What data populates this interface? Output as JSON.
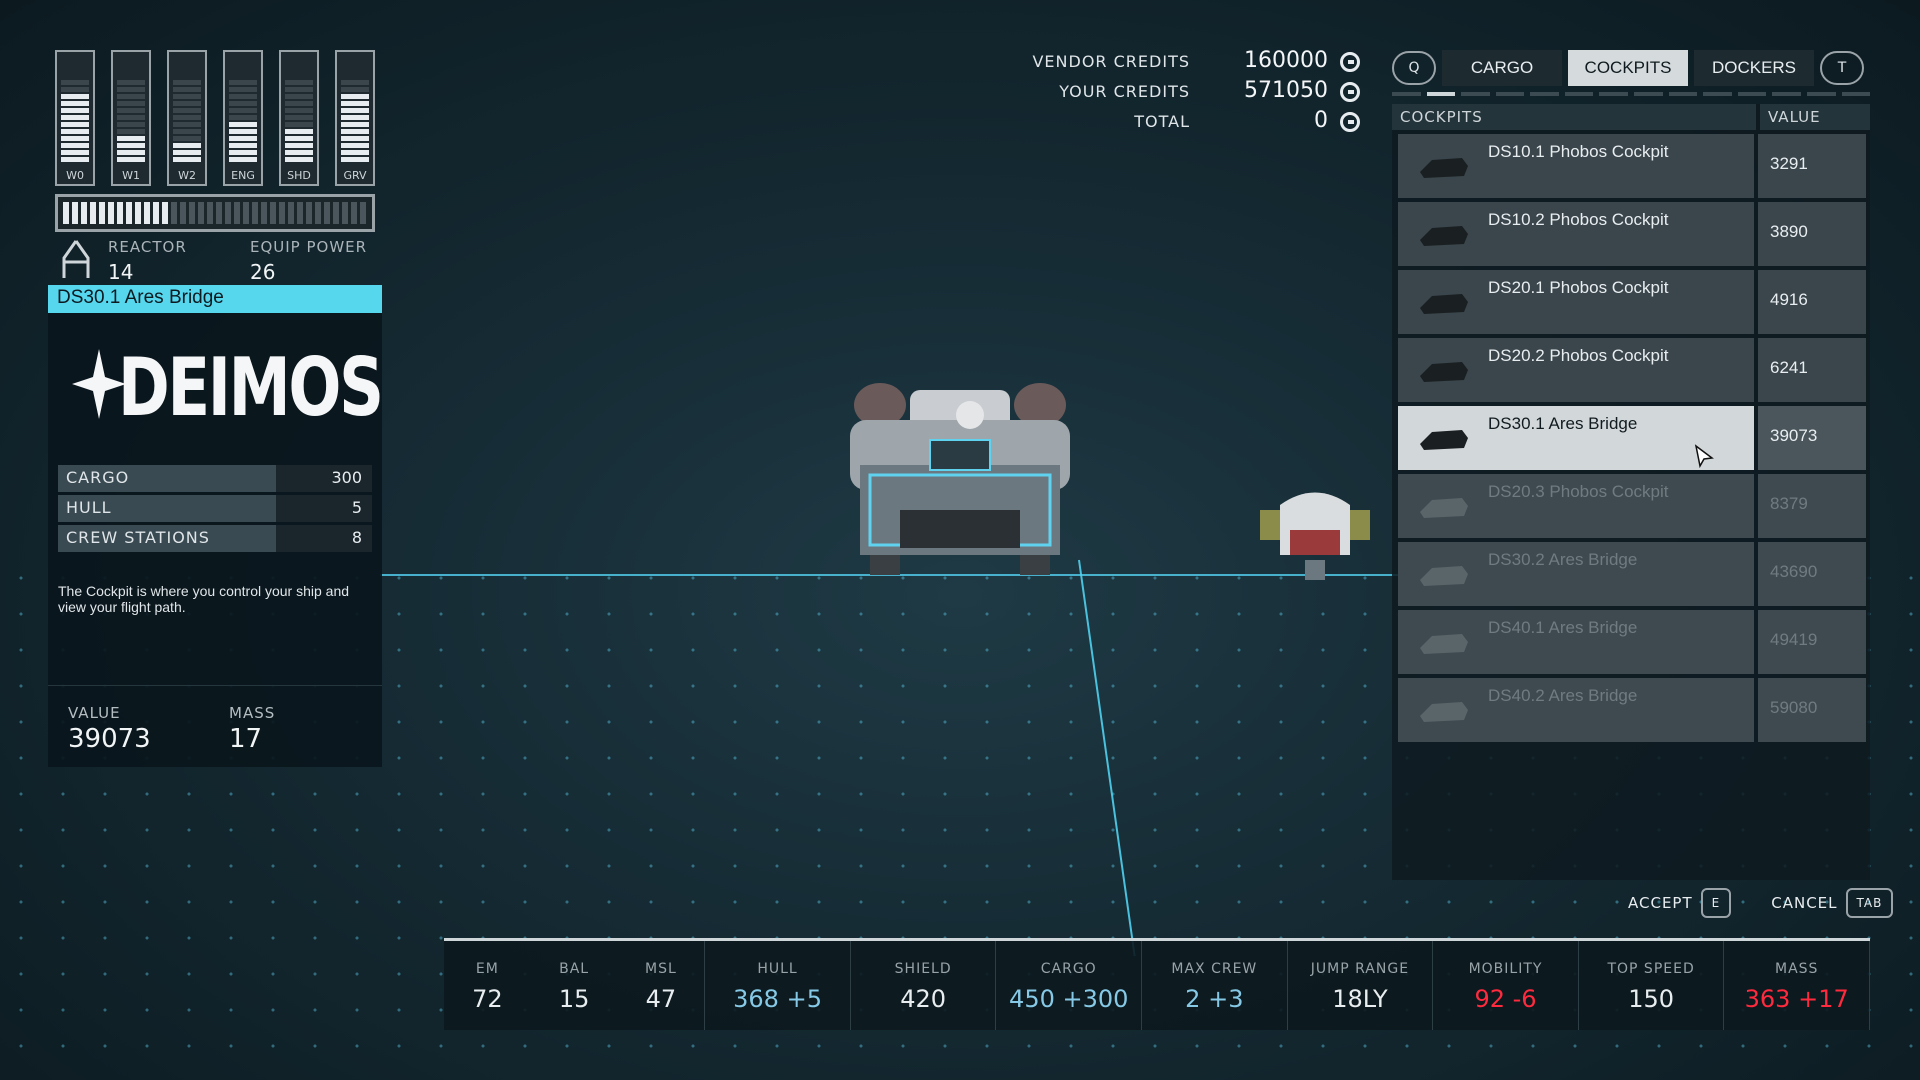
{
  "power_bars": [
    {
      "label": "W0",
      "level": 10
    },
    {
      "label": "W1",
      "level": 4
    },
    {
      "label": "W2",
      "level": 3
    },
    {
      "label": "ENG",
      "level": 6
    },
    {
      "label": "SHD",
      "level": 5
    },
    {
      "label": "GRV",
      "level": 10
    }
  ],
  "reactor": {
    "label": "REACTOR",
    "value": "14",
    "equip_label": "EQUIP POWER",
    "equip_value": "26",
    "fill": 0.35
  },
  "module": {
    "title": "DS30.1 Ares Bridge",
    "brand": "DEIMOS",
    "stats": [
      {
        "label": "CARGO",
        "value": "300"
      },
      {
        "label": "HULL",
        "value": "5"
      },
      {
        "label": "CREW STATIONS",
        "value": "8"
      }
    ],
    "description": "The Cockpit is where you control your ship and view your flight path.",
    "value_label": "VALUE",
    "value": "39073",
    "mass_label": "MASS",
    "mass": "17"
  },
  "credits": [
    {
      "label": "VENDOR CREDITS",
      "value": "160000"
    },
    {
      "label": "YOUR CREDITS",
      "value": "571050"
    },
    {
      "label": "TOTAL",
      "value": "0"
    }
  ],
  "tabs": {
    "prev_key": "Q",
    "next_key": "T",
    "items": [
      "CARGO",
      "COCKPITS",
      "DOCKERS"
    ],
    "active": "COCKPITS"
  },
  "list": {
    "col_name": "COCKPITS",
    "col_value": "VALUE",
    "items": [
      {
        "name": "DS10.1 Phobos Cockpit",
        "value": "3291",
        "state": "normal"
      },
      {
        "name": "DS10.2 Phobos Cockpit",
        "value": "3890",
        "state": "normal"
      },
      {
        "name": "DS20.1 Phobos Cockpit",
        "value": "4916",
        "state": "normal"
      },
      {
        "name": "DS20.2 Phobos Cockpit",
        "value": "6241",
        "state": "normal"
      },
      {
        "name": "DS30.1 Ares Bridge",
        "value": "39073",
        "state": "selected"
      },
      {
        "name": "DS20.3 Phobos Cockpit",
        "value": "8379",
        "state": "disabled"
      },
      {
        "name": "DS30.2 Ares Bridge",
        "value": "43690",
        "state": "disabled"
      },
      {
        "name": "DS40.1 Ares Bridge",
        "value": "49419",
        "state": "disabled"
      },
      {
        "name": "DS40.2 Ares Bridge",
        "value": "59080",
        "state": "disabled"
      }
    ]
  },
  "actions": {
    "accept": "ACCEPT",
    "accept_key": "E",
    "cancel": "CANCEL",
    "cancel_key": "TAB"
  },
  "ship_stats": [
    {
      "label": "EM",
      "value": "72",
      "delta": "",
      "tone": "normal"
    },
    {
      "label": "BAL",
      "value": "15",
      "delta": "",
      "tone": "normal"
    },
    {
      "label": "MSL",
      "value": "47",
      "delta": "",
      "tone": "normal"
    },
    {
      "label": "HULL",
      "value": "368",
      "delta": "+5",
      "tone": "up"
    },
    {
      "label": "SHIELD",
      "value": "420",
      "delta": "",
      "tone": "normal"
    },
    {
      "label": "CARGO",
      "value": "450",
      "delta": "+300",
      "tone": "up"
    },
    {
      "label": "MAX CREW",
      "value": "2",
      "delta": "+3",
      "tone": "up"
    },
    {
      "label": "JUMP RANGE",
      "value": "18LY",
      "delta": "",
      "tone": "normal"
    },
    {
      "label": "MOBILITY",
      "value": "92",
      "delta": "-6",
      "tone": "down"
    },
    {
      "label": "TOP SPEED",
      "value": "150",
      "delta": "",
      "tone": "normal"
    },
    {
      "label": "MASS",
      "value": "363",
      "delta": "+17",
      "tone": "down"
    }
  ],
  "colors": {
    "accent": "#56d7ee",
    "positive": "#86c9e6",
    "negative": "#ff2a3d"
  }
}
